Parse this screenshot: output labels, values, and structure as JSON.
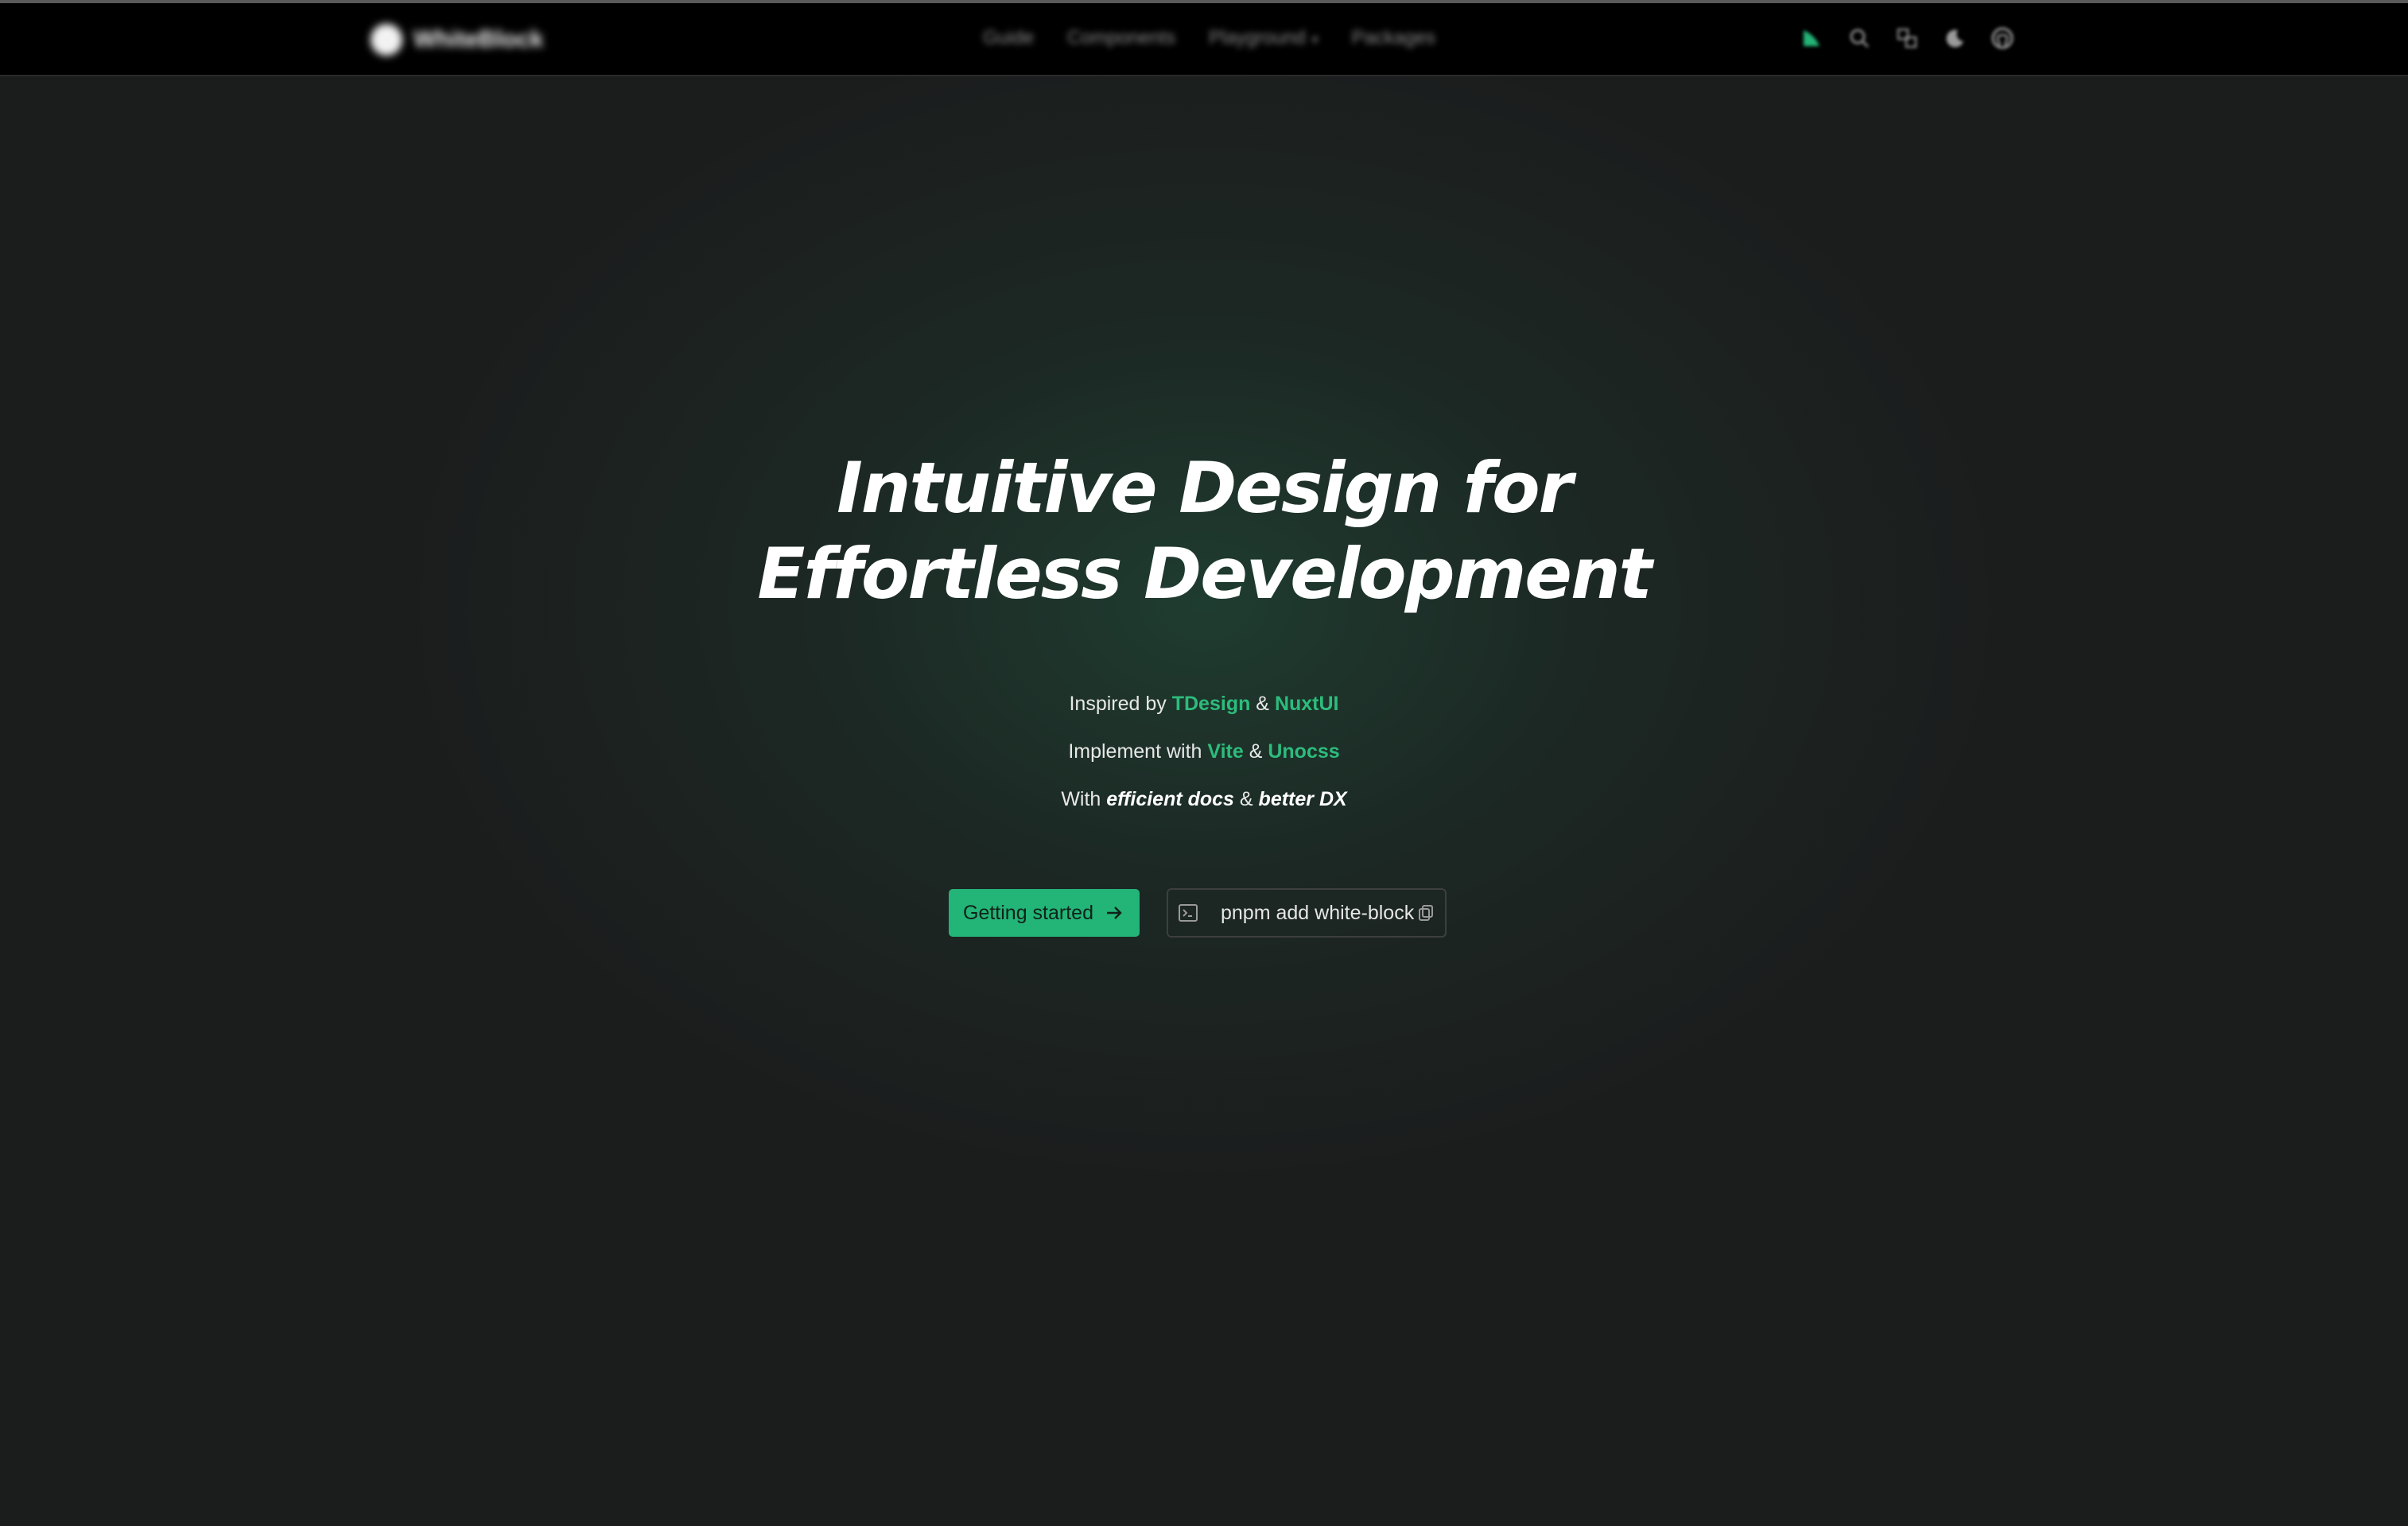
{
  "navbar": {
    "brand": "WhiteBlock",
    "links": [
      {
        "label": "Guide"
      },
      {
        "label": "Components"
      },
      {
        "label": "Playground"
      },
      {
        "label": "Packages"
      }
    ],
    "icons": [
      "brand-icon",
      "search-icon",
      "translate-icon",
      "moon-icon",
      "github-icon"
    ]
  },
  "hero": {
    "title_line1": "Intuitive Design for",
    "title_line2": "Effortless Development"
  },
  "taglines": [
    {
      "prefix": "Inspired by ",
      "a": "TDesign",
      "sep": " & ",
      "b": "NuxtUI"
    },
    {
      "prefix": "Implement with ",
      "a": "Vite",
      "sep": " & ",
      "b": "Unocss"
    },
    {
      "prefix": "With ",
      "a": "efficient docs",
      "sep": " & ",
      "b": "better DX"
    }
  ],
  "cta": {
    "primary_label": "Getting started",
    "command": "pnpm add white-block"
  },
  "colors": {
    "accent": "#23b477",
    "background": "#1b1c1c",
    "navbar": "#000000"
  }
}
